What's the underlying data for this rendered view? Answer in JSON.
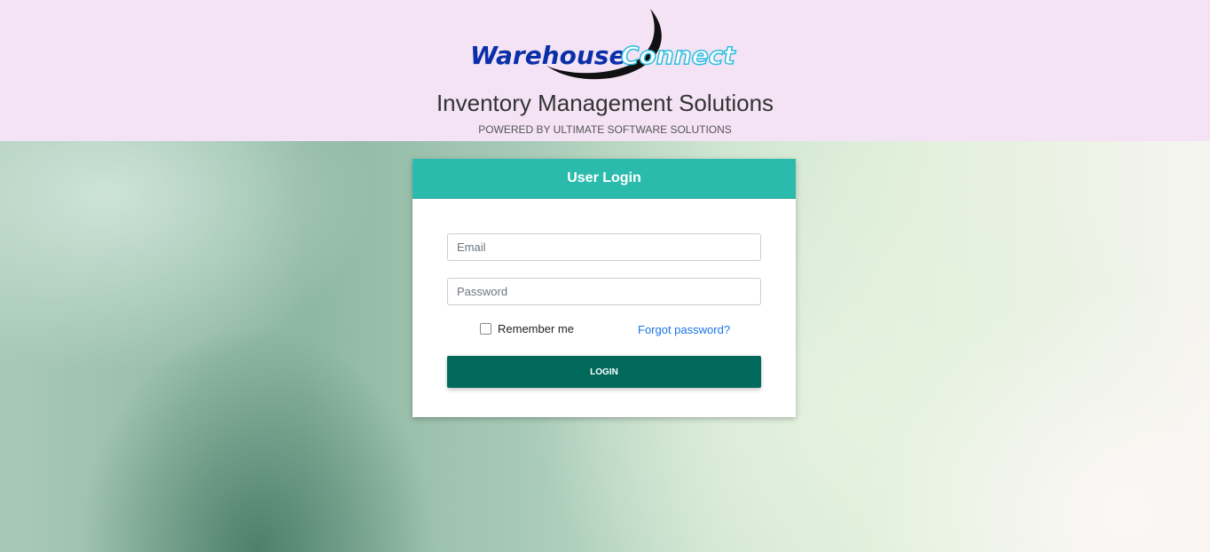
{
  "header": {
    "logo_text_1": "Warehouse",
    "logo_text_2": "Connect",
    "title": "Inventory Management Solutions",
    "subtitle": "POWERED BY ULTIMATE SOFTWARE SOLUTIONS"
  },
  "login": {
    "heading": "User Login",
    "email_placeholder": "Email",
    "password_placeholder": "Password",
    "remember_label": "Remember me",
    "forgot_label": "Forgot password?",
    "login_label": "LOGIN"
  },
  "colors": {
    "header_bg": "#f3e3f5",
    "card_header": "#2bbbad",
    "button": "#00695c",
    "link": "#1a73e8"
  }
}
